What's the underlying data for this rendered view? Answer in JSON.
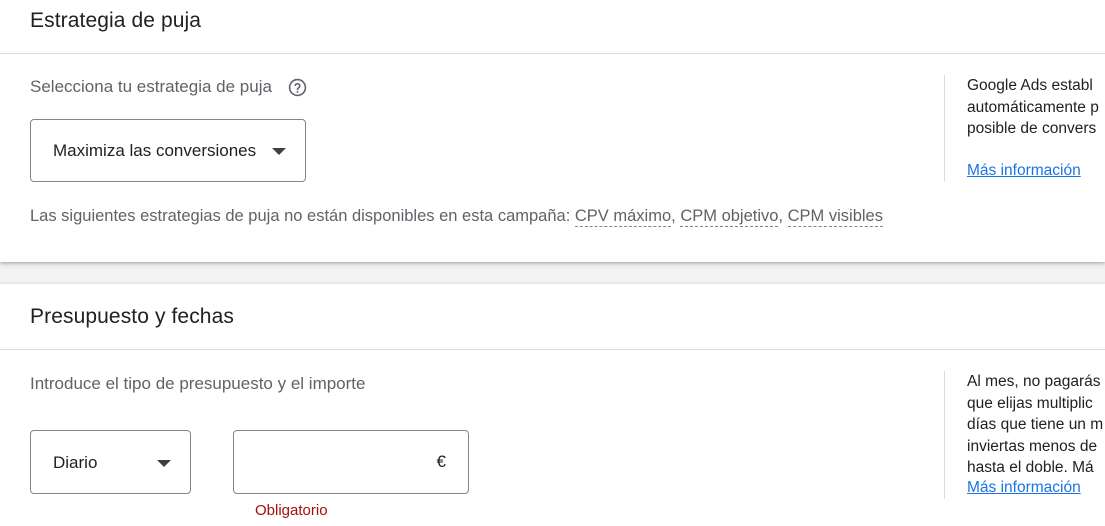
{
  "bidding": {
    "title": "Estrategia de puja",
    "select_label": "Selecciona tu estrategia de puja",
    "help_icon": "help-circle-icon",
    "strategy_value": "Maximiza las conversiones",
    "unavailable_prefix": "Las siguientes estrategias de puja no están disponibles en esta campaña: ",
    "unavailable": [
      "CPV máximo",
      "CPM objetivo",
      "CPM visibles"
    ],
    "side_lines": [
      "Google Ads establ",
      "automáticamente p",
      "posible de convers"
    ],
    "more_info": "Más información"
  },
  "budget": {
    "title": "Presupuesto y fechas",
    "label": "Introduce el tipo de presupuesto y el importe",
    "type_value": "Diario",
    "amount_value": "",
    "currency": "€",
    "error": "Obligatorio",
    "side_lines": [
      "Al mes, no pagarás",
      "que elijas multiplic",
      "días que tiene un m",
      "inviertas menos de",
      "hasta el doble. Má"
    ],
    "more_info": "Más información"
  },
  "colors": {
    "link": "#1a73e8",
    "error": "#a50e0e",
    "text": "#202124",
    "secondary_text": "#5f6368",
    "divider": "#dadce0",
    "background": "#f1f3f4"
  }
}
